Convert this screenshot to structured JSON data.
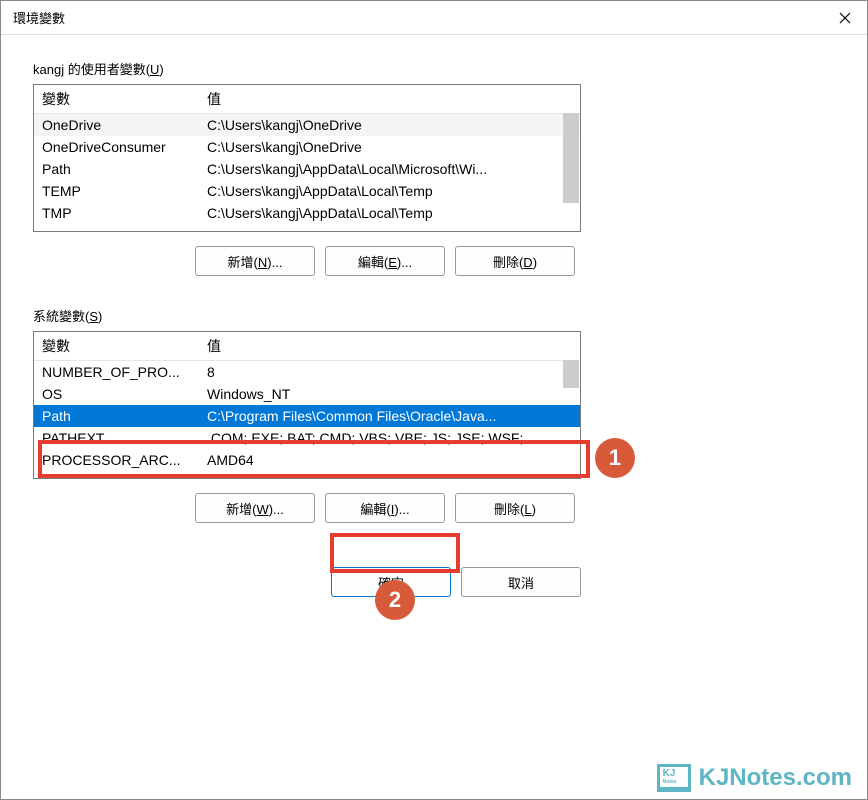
{
  "window": {
    "title": "環境變數"
  },
  "userSection": {
    "label": "kangj 的使用者變數(",
    "accel": "U",
    "labelEnd": ")",
    "headers": {
      "variable": "變數",
      "value": "值"
    },
    "rows": [
      {
        "var": "OneDrive",
        "val": "C:\\Users\\kangj\\OneDrive"
      },
      {
        "var": "OneDriveConsumer",
        "val": "C:\\Users\\kangj\\OneDrive"
      },
      {
        "var": "Path",
        "val": "C:\\Users\\kangj\\AppData\\Local\\Microsoft\\Wi..."
      },
      {
        "var": "TEMP",
        "val": "C:\\Users\\kangj\\AppData\\Local\\Temp"
      },
      {
        "var": "TMP",
        "val": "C:\\Users\\kangj\\AppData\\Local\\Temp"
      }
    ],
    "buttons": {
      "new": "新增(N)...",
      "edit": "編輯(E)...",
      "delete": "刪除(D)"
    }
  },
  "systemSection": {
    "label": "系統變數(",
    "accel": "S",
    "labelEnd": ")",
    "headers": {
      "variable": "變數",
      "value": "值"
    },
    "rows": [
      {
        "var": "NUMBER_OF_PRO...",
        "val": "8"
      },
      {
        "var": "OS",
        "val": "Windows_NT"
      },
      {
        "var": "Path",
        "val": "C:\\Program Files\\Common Files\\Oracle\\Java...",
        "selected": true
      },
      {
        "var": "PATHEXT",
        "val": ".COM;.EXE;.BAT;.CMD;.VBS;.VBE;.JS;.JSE;.WSF;..."
      },
      {
        "var": "PROCESSOR_ARC...",
        "val": "AMD64"
      }
    ],
    "buttons": {
      "new": "新增(W)...",
      "edit": "編輯(I)...",
      "delete": "刪除(L)"
    }
  },
  "dialog": {
    "ok": "確定",
    "cancel": "取消"
  },
  "annotations": {
    "badge1": "1",
    "badge2": "2"
  },
  "watermark": "KJNotes.com"
}
